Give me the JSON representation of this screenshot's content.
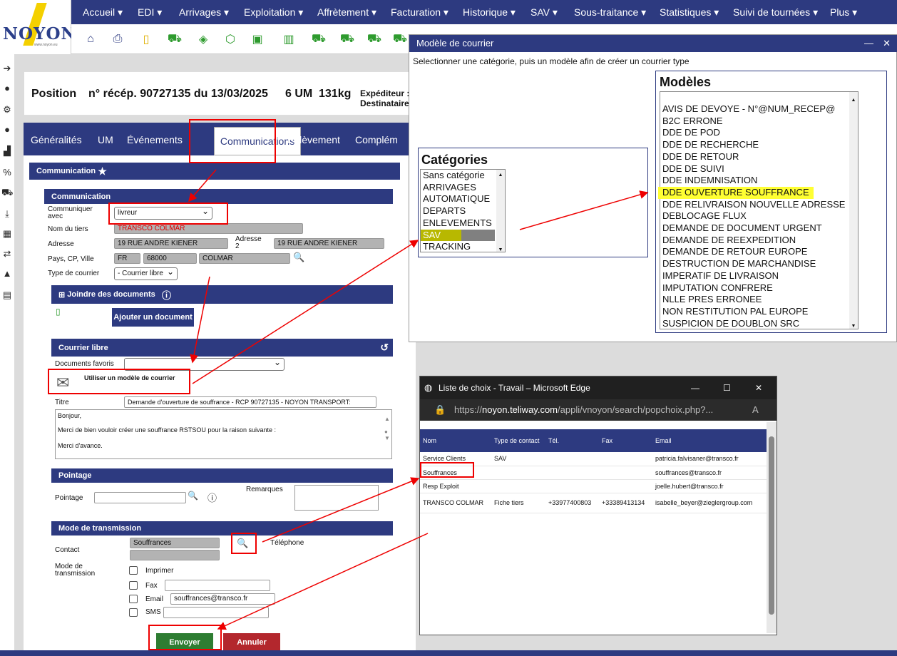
{
  "nav": {
    "logo_text": "NOYON",
    "logo_url": "www.noyon.eu",
    "items": [
      "Accueil",
      "EDI",
      "Arrivages",
      "Exploitation",
      "Affrètement",
      "Facturation",
      "Historique",
      "SAV",
      "Sous-traitance",
      "Statistiques",
      "Suivi de tournées",
      "Plus"
    ]
  },
  "header": {
    "position": "Position",
    "recep": "n° récép. 90727135 du 13/03/2025",
    "um": "6 UM",
    "weight": "131kg",
    "expediteur": "Expéditeur :",
    "destinataire": "Destinataire"
  },
  "tabs": [
    "Généralités",
    "UM",
    "Événements",
    "Communications",
    "Enlèvement",
    "Complém"
  ],
  "form": {
    "communication_title": "Communication",
    "section_communication": "Communication",
    "communiquer_label": "Communiquer avec",
    "communiquer_value": "livreur",
    "nom_tiers_label": "Nom du tiers",
    "nom_tiers_value": "TRANSCO COLMAR",
    "adresse_label": "Adresse",
    "adresse_value": "19 RUE ANDRE KIENER",
    "adresse2_label": "Adresse 2",
    "adresse2_value": "19 RUE ANDRE KIENER",
    "pays_label": "Pays, CP, Ville",
    "pays": "FR",
    "cp": "68000",
    "ville": "COLMAR",
    "type_courrier_label": "Type de courrier",
    "type_courrier_value": "- Courrier libre",
    "joindre_title": "Joindre des documents",
    "ajouter_doc": "Ajouter un document",
    "courrier_libre_title": "Courrier libre",
    "docs_favoris_label": "Documents favoris",
    "modele_label": "Utiliser un modèle de courrier",
    "titre_label": "Titre",
    "titre_value": "Demande d'ouverture de souffrance - RCP 90727135 - NOYON TRANSPORT:",
    "body_lines": [
      "Bonjour,",
      "Merci de bien vouloir créer une souffrance RSTSOU pour la raison suivante :",
      "Merci d'avance."
    ],
    "pointage_title": "Pointage",
    "pointage_label": "Pointage",
    "remarques_label": "Remarques",
    "transmission_title": "Mode de transmission",
    "contact_label": "Contact",
    "contact_value": "Souffrances",
    "telephone_label": "Téléphone",
    "mode_label": "Mode de transmission",
    "imprimer": "Imprimer",
    "fax": "Fax",
    "email": "Email",
    "email_value": "souffrances@transco.fr",
    "sms": "SMS",
    "envoyer": "Envoyer",
    "annuler": "Annuler"
  },
  "modal": {
    "title": "Modèle de courrier",
    "instruction": "Selectionner une catégorie, puis un modèle afin de créer un courrier type",
    "categories_title": "Catégories",
    "categories": [
      "Sans catégorie",
      "ARRIVAGES",
      "AUTOMATIQUE",
      "DEPARTS",
      "ENLEVEMENTS",
      "SAV",
      "TRACKING"
    ],
    "selected_category": "SAV",
    "modeles_title": "Modèles",
    "modeles": [
      "AVIS DE DEVOYE - N°@NUM_RECEP@",
      "B2C ERRONE",
      "DDE DE POD",
      "DDE DE RECHERCHE",
      "DDE DE RETOUR",
      "DDE DE SUIVI",
      "DDE INDEMNISATION",
      "DDE OUVERTURE SOUFFRANCE",
      "DDE RELIVRAISON NOUVELLE ADRESSE",
      "DEBLOCAGE FLUX",
      "DEMANDE DE DOCUMENT URGENT",
      "DEMANDE DE REEXPEDITION",
      "DEMANDE DE RETOUR EUROPE",
      "DESTRUCTION DE MARCHANDISE",
      "IMPERATIF DE LIVRAISON",
      "IMPUTATION CONFRERE",
      "NLLE PRES ERRONEE",
      "NON RESTITUTION PAL EUROPE",
      "SUSPICION DE DOUBLON SRC"
    ],
    "highlighted_modele": "DDE OUVERTURE SOUFFRANCE"
  },
  "edge": {
    "title": "Liste de choix - Travail – Microsoft Edge",
    "url_prefix": "https://",
    "url_host": "noyon.teliway.com",
    "url_path": "/appli/vnoyon/search/popchoix.php?...",
    "columns": [
      "Nom",
      "Type de contact",
      "Tél.",
      "Fax",
      "Email"
    ],
    "rows": [
      [
        "Service Clients",
        "SAV",
        "",
        "",
        "patricia.falvisaner@transco.fr"
      ],
      [
        "Souffrances",
        "",
        "",
        "",
        "souffrances@transco.fr"
      ],
      [
        "Resp Exploit",
        "",
        "",
        "",
        "joelle.hubert@transco.fr"
      ],
      [
        "TRANSCO COLMAR",
        "Fiche tiers",
        "+33977400803",
        "+33389413134",
        "isabelle_beyer@zieglergroup.com"
      ]
    ]
  },
  "colors": {
    "primary": "#2d3a80",
    "highlight": "#ffff33",
    "annuler": "#b3272d",
    "envoyer": "#2e7d32",
    "annotation": "#e00000"
  }
}
